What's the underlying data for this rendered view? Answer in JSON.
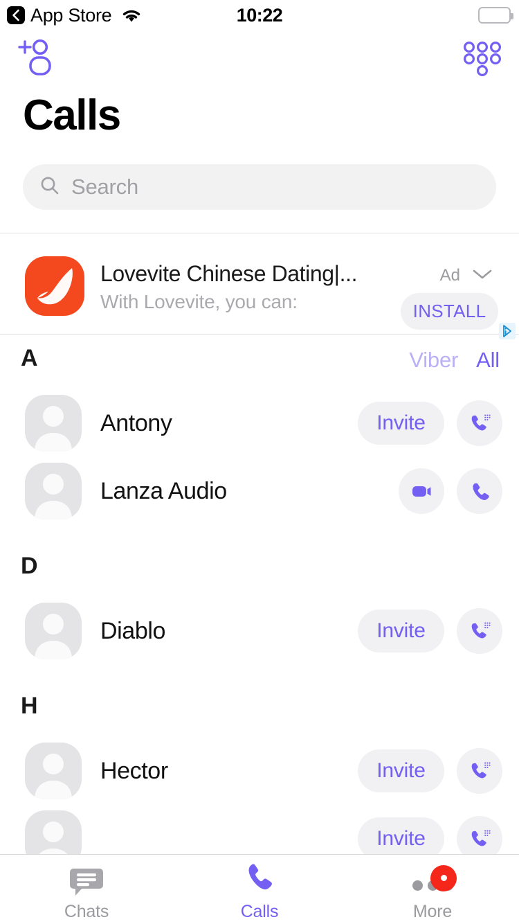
{
  "status_bar": {
    "back_label": "App Store",
    "back_icon": "chevron-left-icon",
    "wifi_icon": "wifi-icon",
    "time": "10:22",
    "battery_icon": "battery-full-icon"
  },
  "nav": {
    "add_contact_icon": "add-contact-icon",
    "keypad_icon": "dialpad-icon"
  },
  "header": {
    "title": "Calls"
  },
  "search": {
    "placeholder": "Search",
    "icon": "search-icon"
  },
  "ad": {
    "label": "Ad",
    "chevron_icon": "chevron-down-icon",
    "app_icon": "lovevite-app-icon",
    "title": "Lovevite Chinese Dating|...",
    "subtitle": "With Lovevite, you can:",
    "cta_label": "INSTALL",
    "adchoices_icon": "adchoices-icon"
  },
  "filters": {
    "items": [
      {
        "label": "Viber",
        "active": false
      },
      {
        "label": "All",
        "active": true
      }
    ]
  },
  "sections": [
    {
      "letter": "A",
      "contacts": [
        {
          "name": "Antony",
          "avatar_icon": "default-avatar-icon",
          "invite_label": "Invite",
          "actions": [
            "viber-out-call-icon"
          ]
        },
        {
          "name": "Lanza Audio",
          "avatar_icon": "default-avatar-icon",
          "invite_label": null,
          "actions": [
            "video-call-icon",
            "voice-call-icon"
          ]
        }
      ]
    },
    {
      "letter": "D",
      "contacts": [
        {
          "name": "Diablo",
          "avatar_icon": "default-avatar-icon",
          "invite_label": "Invite",
          "actions": [
            "viber-out-call-icon"
          ]
        }
      ]
    },
    {
      "letter": "H",
      "contacts": [
        {
          "name": "Hector",
          "avatar_icon": "default-avatar-icon",
          "invite_label": "Invite",
          "actions": [
            "viber-out-call-icon"
          ]
        },
        {
          "name": "",
          "avatar_icon": "default-avatar-icon",
          "invite_label": "Invite",
          "actions": [
            "viber-out-call-icon"
          ]
        }
      ]
    }
  ],
  "tabbar": {
    "items": [
      {
        "label": "Chats",
        "icon": "chat-bubble-icon",
        "active": false,
        "badge": null
      },
      {
        "label": "Calls",
        "icon": "phone-icon",
        "active": true,
        "badge": null
      },
      {
        "label": "More",
        "icon": "more-dots-icon",
        "active": false,
        "badge": "dot"
      }
    ]
  },
  "colors": {
    "brand_purple": "#7360f2",
    "inactive_purple": "#b9b0f5",
    "ad_orange": "#f4491f",
    "badge_red": "#f5271b",
    "chip_gray": "#f1f1f3",
    "text_gray": "#9a9a9f"
  }
}
